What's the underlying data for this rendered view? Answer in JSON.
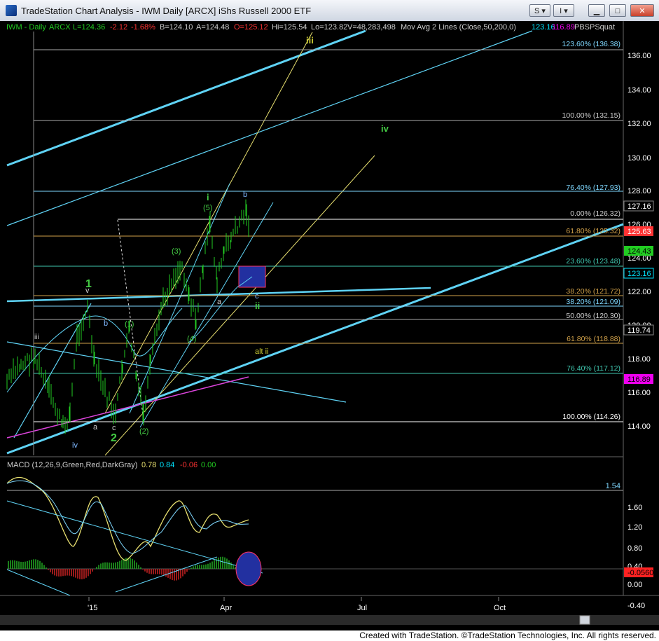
{
  "window": {
    "title": "TradeStation Chart Analysis - IWM Daily [ARCX] iShs Russell 2000 ETF",
    "buttons": {
      "s_label": "S",
      "i_label": "I"
    }
  },
  "legend": {
    "symbol": "IWM - Daily",
    "exchange": "ARCX",
    "last": "L=124.36",
    "change": "-2.12",
    "change_pct": "-1.68%",
    "bid": "B=124.10",
    "ask": "A=124.48",
    "open": "O=125.12",
    "high": "Hi=125.54",
    "low": "Lo=123.82",
    "volume": "V=48,283,498",
    "ma_label": "Mov Avg 2 Lines (Close,50,200,0)",
    "ma_val1": "123.16",
    "ma_val2": "116.89",
    "indicator": "PBSPSquat"
  },
  "macd_legend": {
    "label": "MACD (12,26,9,Green,Red,DarkGray)",
    "v1": "0.78",
    "v2": "0.84",
    "v3": "-0.06",
    "v4": "0.00"
  },
  "price_axis": [
    "136.00",
    "134.00",
    "132.00",
    "130.00",
    "128.00",
    "126.00",
    "124.00",
    "122.00",
    "120.00",
    "118.00",
    "116.00",
    "114.00"
  ],
  "price_tags": [
    {
      "label": "127.16",
      "bg": "#000000",
      "fg": "#ffffff",
      "border": "#888888"
    },
    {
      "label": "125.63",
      "bg": "#ff3333",
      "fg": "#ffffff",
      "border": "#ff3333"
    },
    {
      "label": "124.43",
      "bg": "#22cc22",
      "fg": "#000000",
      "border": "#22cc22"
    },
    {
      "label": "123.16",
      "bg": "#000000",
      "fg": "#00e5ff",
      "border": "#00e5ff"
    },
    {
      "label": "119.74",
      "bg": "#000000",
      "fg": "#ffffff",
      "border": "#888888"
    },
    {
      "label": "116.89",
      "bg": "#ee00ee",
      "fg": "#000000",
      "border": "#ee00ee"
    }
  ],
  "fib_levels": [
    {
      "label": "123.60% (136.38)",
      "color": "#7fd8ff"
    },
    {
      "label": "100.00% (132.15)",
      "color": "#cccccc"
    },
    {
      "label": "76.40% (127.93)",
      "color": "#7fd8ff"
    },
    {
      "label": "0.00% (126.32)",
      "color": "#cccccc"
    },
    {
      "label": "61.80% (125.32)",
      "color": "#d2a24a"
    },
    {
      "label": "23.60% (123.48)",
      "color": "#40c8b0"
    },
    {
      "label": "38.20% (121.72)",
      "color": "#d2a24a"
    },
    {
      "label": "38.20% (121.09)",
      "color": "#7fd8ff"
    },
    {
      "label": "50.00% (120.30)",
      "color": "#cccccc"
    },
    {
      "label": "61.80% (118.88)",
      "color": "#d2a24a"
    },
    {
      "label": "76.40% (117.12)",
      "color": "#40c8b0"
    },
    {
      "label": "100.00% (114.26)",
      "color": "#ffffff"
    }
  ],
  "wave_labels": [
    {
      "label": "iii",
      "color": "#cccc33"
    },
    {
      "label": "iv",
      "color": "#44cc44"
    },
    {
      "label": "i",
      "color": "#44cc44"
    },
    {
      "label": "(5)",
      "color": "#44cc44"
    },
    {
      "label": "b",
      "color": "#7fb8ff"
    },
    {
      "label": "(3)",
      "color": "#44cc44"
    },
    {
      "label": "1",
      "color": "#44cc44"
    },
    {
      "label": "v",
      "color": "#cccccc"
    },
    {
      "label": "b",
      "color": "#7fb8ff"
    },
    {
      "label": "a",
      "color": "#cccccc"
    },
    {
      "label": "c",
      "color": "#7fb8ff"
    },
    {
      "label": "ii",
      "color": "#44cc44"
    },
    {
      "label": "(1)",
      "color": "#44cc44"
    },
    {
      "label": "(4)",
      "color": "#44cc44"
    },
    {
      "label": "alt ii",
      "color": "#cccc33"
    },
    {
      "label": "iii",
      "color": "#cccccc"
    },
    {
      "label": "a",
      "color": "#cccccc"
    },
    {
      "label": "c",
      "color": "#cccccc"
    },
    {
      "label": "2",
      "color": "#44cc44"
    },
    {
      "label": "(2)",
      "color": "#44cc44"
    },
    {
      "label": "iv",
      "color": "#7fb8ff"
    }
  ],
  "macd_axis": [
    "1.60",
    "1.20",
    "0.80",
    "0.40",
    "0.00",
    "-0.40"
  ],
  "macd_tags": [
    {
      "label": "1.54",
      "bg": "#000000",
      "fg": "#7fd8ff"
    },
    {
      "label": "-0.0560",
      "bg": "#ff2222",
      "fg": "#000000"
    }
  ],
  "time_axis": [
    "'15",
    "Apr",
    "Jul",
    "Oct"
  ],
  "footer": "Created with TradeStation. ©TradeStation Technologies, Inc. All rights reserved."
}
